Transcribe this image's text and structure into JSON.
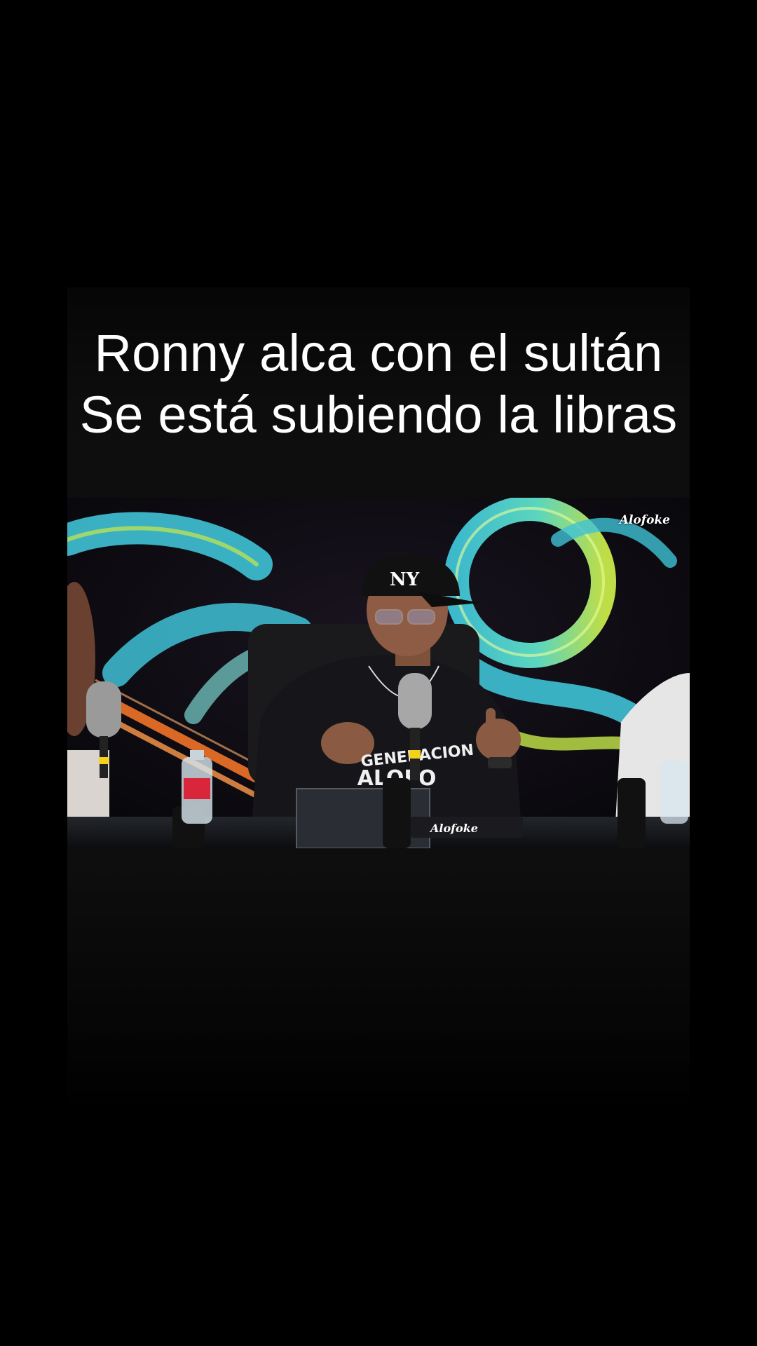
{
  "caption": {
    "line1": "Ronny alca con el sultán",
    "line2": "Se está subiendo la libras"
  },
  "video": {
    "channel_logo": "Alofoke",
    "cap_logo": "NY",
    "hoodie_text_1": "GENERACION",
    "hoodie_text_2": "ALOFO",
    "desk_logo": "Alofoke",
    "colors": {
      "background": "#000000",
      "swirl_cyan": "#3fc2d6",
      "swirl_lime": "#c7e84a",
      "studio_orange": "#ff7a2a"
    }
  }
}
